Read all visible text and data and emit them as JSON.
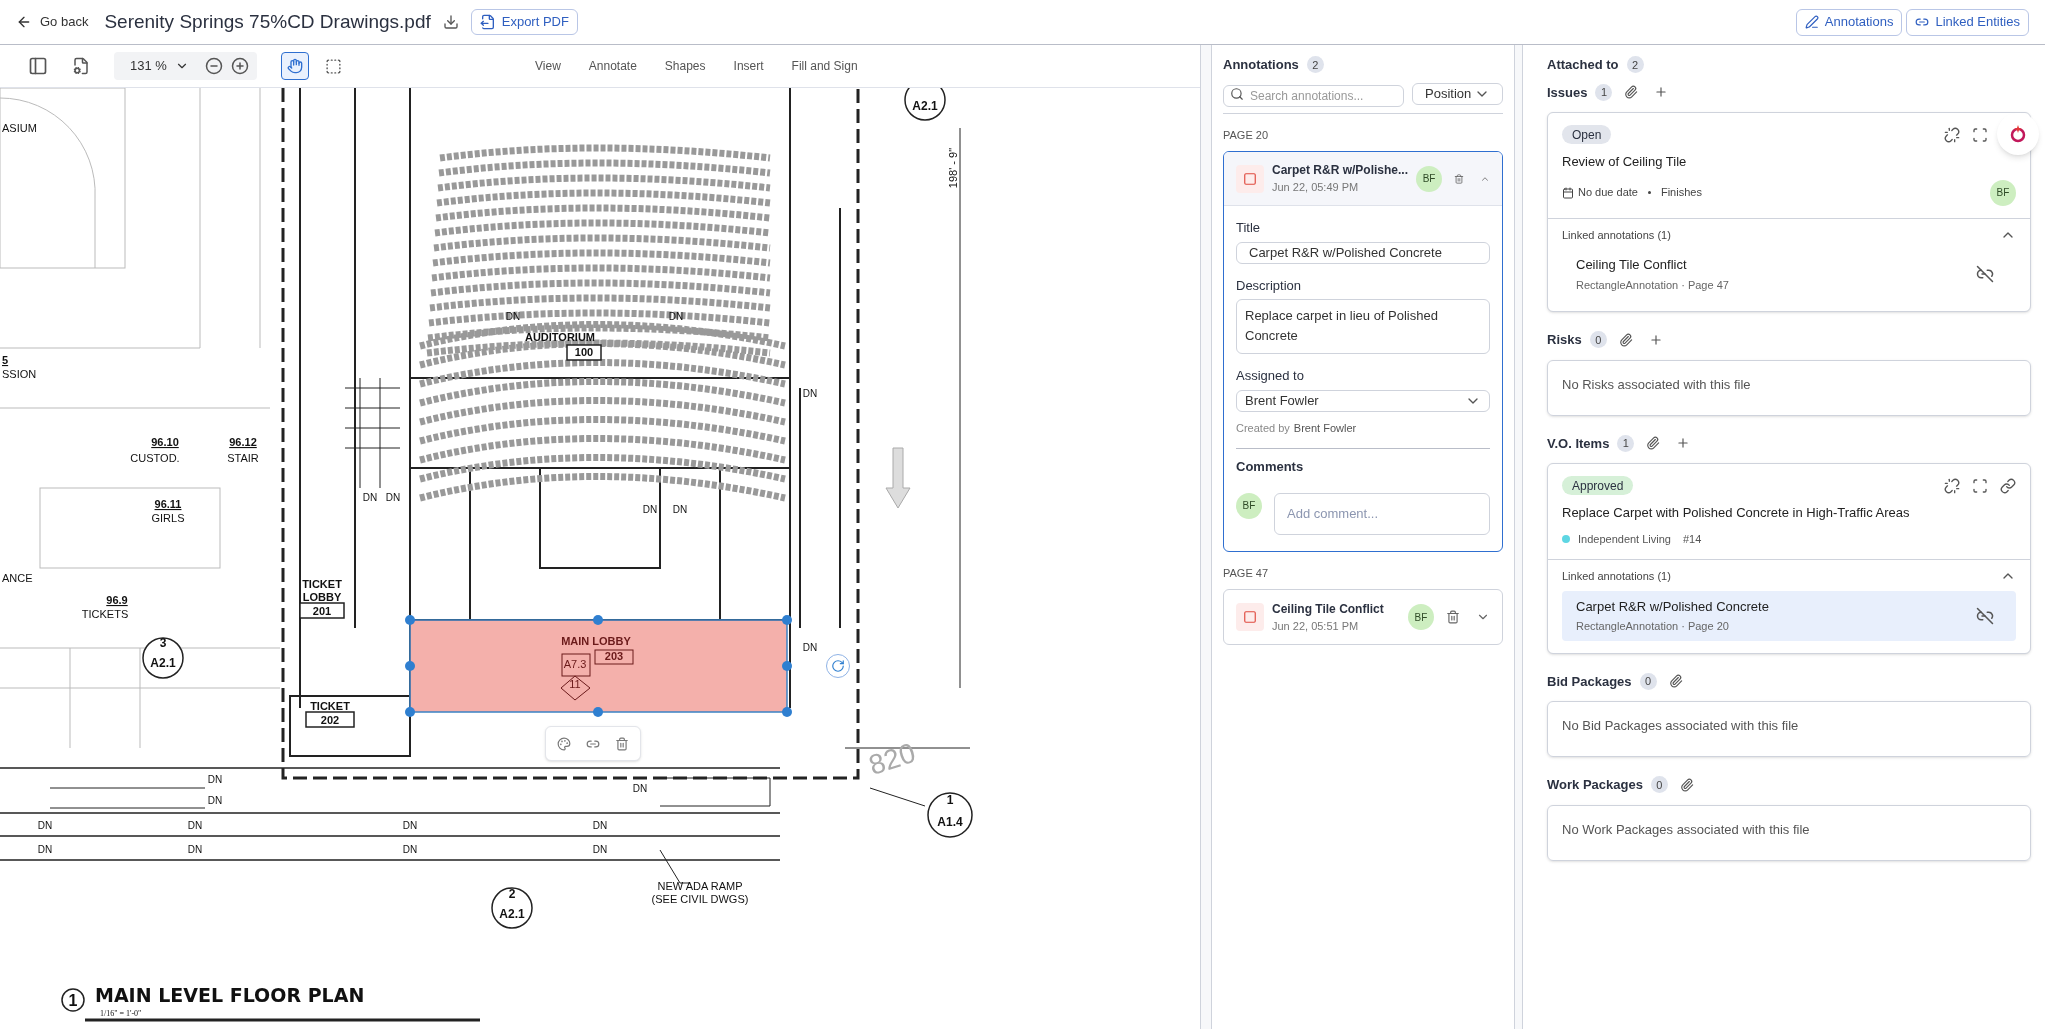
{
  "header": {
    "back": "Go back",
    "title": "Serenity Springs 75%CD Drawings.pdf",
    "export": "Export PDF",
    "panel_buttons": [
      {
        "label": "Annotations",
        "kind": "annotations"
      },
      {
        "label": "Linked Entities",
        "kind": "links"
      }
    ]
  },
  "toolbar": {
    "zoom": "131 %",
    "pan_selected": true,
    "menu": [
      "View",
      "Annotate",
      "Shapes",
      "Insert",
      "Fill and Sign"
    ]
  },
  "plan": {
    "labels": [
      {
        "text": "ASIUM",
        "kind": "room"
      },
      {
        "text": "5",
        "kind": "number"
      },
      {
        "text": "SSION",
        "kind": "room"
      },
      {
        "text": "96.10",
        "kind": "number"
      },
      {
        "text": "CUSTOD.",
        "kind": "room"
      },
      {
        "text": "96.12",
        "kind": "number"
      },
      {
        "text": "STAIR",
        "kind": "room"
      },
      {
        "text": "96.11",
        "kind": "number"
      },
      {
        "text": "GIRLS",
        "kind": "room"
      },
      {
        "text": "ANCE",
        "kind": "room"
      },
      {
        "text": "96.9",
        "kind": "number"
      },
      {
        "text": "TICKETS",
        "kind": "room"
      },
      {
        "text": "AUDITORIUM",
        "kind": "bold"
      },
      {
        "text": "100",
        "kind": "boxed"
      },
      {
        "text": "TICKET",
        "kind": "bold"
      },
      {
        "text": "LOBBY",
        "kind": "bold"
      },
      {
        "text": "201",
        "kind": "boxed"
      },
      {
        "text": "MAIN LOBBY",
        "kind": "lobby"
      },
      {
        "text": "203",
        "kind": "lobbybox"
      },
      {
        "text": "A7.3",
        "kind": "lobbytag"
      },
      {
        "text": "11",
        "kind": "lobbytag"
      },
      {
        "text": "TICKET",
        "kind": "bold"
      },
      {
        "text": "202",
        "kind": "boxed"
      },
      {
        "text": "3",
        "kind": "tag"
      },
      {
        "text": "A2.1",
        "kind": "tag"
      },
      {
        "text": "A2.1",
        "kind": "tag"
      },
      {
        "text": "198' - 9\"",
        "kind": "dim"
      },
      {
        "text": "820",
        "kind": "faint"
      },
      {
        "text": "1",
        "kind": "tag"
      },
      {
        "text": "A1.4",
        "kind": "tag"
      },
      {
        "text": "2",
        "kind": "tag"
      },
      {
        "text": "A2.1",
        "kind": "tag"
      },
      {
        "text": "NEW ADA RAMP",
        "kind": "room"
      },
      {
        "text": "(SEE CIVIL DWGS)",
        "kind": "room"
      },
      {
        "text": "1",
        "kind": "titletag"
      },
      {
        "text": "MAIN LEVEL FLOOR PLAN",
        "kind": "title"
      },
      {
        "text": "1/16\" = 1'-0\"",
        "kind": "scale"
      }
    ],
    "dn_marks": [
      "DN",
      "DN",
      "DN",
      "DN",
      "DN",
      "DN",
      "DN",
      "DN",
      "DN",
      "DN",
      "DN",
      "DN",
      "DN",
      "DN",
      "DN",
      "DN",
      "DN",
      "DN",
      "DN"
    ]
  },
  "annotations": {
    "title": "Annotations",
    "count": "2",
    "search": {
      "placeholder": "Search annotations..."
    },
    "sort": "Position",
    "groups": [
      {
        "page": "PAGE 20",
        "items": [
          {
            "title": "Carpet R&R w/Polishe...",
            "date": "Jun 22, 05:49 PM",
            "avatar": "BF",
            "selected": true,
            "expanded": true,
            "form": {
              "title_label": "Title",
              "title_value": "Carpet R&R w/Polished Concrete",
              "description_label": "Description",
              "description_value": "Replace carpet in lieu of Polished Concrete",
              "assigned_label": "Assigned to",
              "assigned_value": "Brent Fowler",
              "created_label": "Created by",
              "created_by": "Brent Fowler",
              "comments_label": "Comments",
              "comment_avatar": "BF",
              "comment_placeholder": "Add comment..."
            }
          }
        ]
      },
      {
        "page": "PAGE 47",
        "items": [
          {
            "title": "Ceiling Tile Conflict",
            "date": "Jun 22, 05:51 PM",
            "avatar": "BF",
            "selected": false,
            "expanded": false
          }
        ]
      }
    ]
  },
  "attached": {
    "title": "Attached to",
    "count": "2",
    "sections": [
      {
        "title": "Issues",
        "count": "1",
        "can_add": true,
        "items": [
          {
            "kind": "issue",
            "status": {
              "label": "Open",
              "color": "#e2e5ec"
            },
            "title": "Review of Ceiling Tile",
            "due": "No due date",
            "category": "Finishes",
            "avatar": "BF",
            "linked": {
              "label": "Linked annotations (1)",
              "expanded": true,
              "items": [
                {
                  "title": "Ceiling Tile Conflict",
                  "subtitle": "RectangleAnnotation · Page 47",
                  "selected": false
                }
              ]
            }
          }
        ]
      },
      {
        "title": "Risks",
        "count": "0",
        "can_add": true,
        "empty": "No Risks associated with this file"
      },
      {
        "title": "V.O. Items",
        "count": "1",
        "can_add": true,
        "items": [
          {
            "kind": "vo",
            "status": {
              "label": "Approved",
              "color": "#d6f0d8"
            },
            "title": "Replace Carpet with Polished Concrete in High-Traffic Areas",
            "project": "Independent Living",
            "color": "#5ed6e3",
            "number": "#14",
            "linked": {
              "label": "Linked annotations (1)",
              "expanded": true,
              "items": [
                {
                  "title": "Carpet R&R w/Polished Concrete",
                  "subtitle": "RectangleAnnotation · Page 20",
                  "selected": true
                }
              ]
            }
          }
        ]
      },
      {
        "title": "Bid Packages",
        "count": "0",
        "can_add": false,
        "empty": "No Bid Packages associated with this file"
      },
      {
        "title": "Work Packages",
        "count": "0",
        "can_add": false,
        "empty": "No Work Packages associated with this file"
      }
    ]
  }
}
